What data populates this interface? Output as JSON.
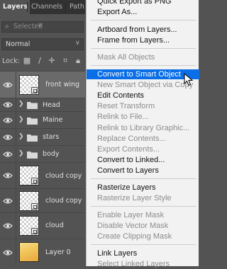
{
  "layers_panel": {
    "tabs": [
      {
        "label": "Layers",
        "active": true
      },
      {
        "label": "Channels",
        "active": false
      },
      {
        "label": "Path",
        "active": false
      }
    ],
    "search": {
      "placeholder": "Selected",
      "icon": "search-icon"
    },
    "blend_mode": "Normal",
    "lock_label": "Lock:",
    "lock_icons": [
      "checkerboard-icon",
      "brush-icon",
      "move-icon",
      "crop-icon"
    ],
    "layers": [
      {
        "name": "front wing",
        "type": "smart-object",
        "visible": true,
        "selected": true
      },
      {
        "name": "Head",
        "type": "group",
        "visible": true,
        "selected": false
      },
      {
        "name": "Maine",
        "type": "group",
        "visible": true,
        "selected": false
      },
      {
        "name": "stars",
        "type": "group",
        "visible": true,
        "selected": false
      },
      {
        "name": "body",
        "type": "group",
        "visible": true,
        "selected": false
      },
      {
        "name": "cloud copy",
        "type": "smart-object",
        "visible": true,
        "selected": false
      },
      {
        "name": "cloud copy",
        "type": "smart-object",
        "visible": true,
        "selected": false
      },
      {
        "name": "cloud",
        "type": "smart-object",
        "visible": true,
        "selected": false
      },
      {
        "name": "Layer 0",
        "type": "pixel",
        "visible": true,
        "selected": false
      }
    ]
  },
  "context_menu": {
    "highlight_color": "#0a6ee6",
    "items": [
      {
        "label": "Quick Export as PNG",
        "enabled": true
      },
      {
        "label": "Export As...",
        "enabled": true
      },
      {
        "label": "Artboard from Layers...",
        "enabled": true
      },
      {
        "label": "Frame from Layers...",
        "enabled": true
      },
      {
        "label": "Mask All Objects",
        "enabled": false
      },
      {
        "label": "Convert to Smart Object",
        "enabled": true,
        "highlighted": true
      },
      {
        "label": "New Smart Object via Copy",
        "enabled": false
      },
      {
        "label": "Edit Contents",
        "enabled": true
      },
      {
        "label": "Reset Transform",
        "enabled": false
      },
      {
        "label": "Relink to File...",
        "enabled": false
      },
      {
        "label": "Relink to Library Graphic...",
        "enabled": false
      },
      {
        "label": "Replace Contents...",
        "enabled": false
      },
      {
        "label": "Export Contents...",
        "enabled": false
      },
      {
        "label": "Convert to Linked...",
        "enabled": true
      },
      {
        "label": "Convert to Layers",
        "enabled": true
      },
      {
        "label": "Rasterize Layers",
        "enabled": true
      },
      {
        "label": "Rasterize Layer Style",
        "enabled": false
      },
      {
        "label": "Enable Layer Mask",
        "enabled": false
      },
      {
        "label": "Disable Vector Mask",
        "enabled": false
      },
      {
        "label": "Create Clipping Mask",
        "enabled": false
      },
      {
        "label": "Link Layers",
        "enabled": true
      },
      {
        "label": "Select Linked Layers",
        "enabled": false
      }
    ]
  }
}
